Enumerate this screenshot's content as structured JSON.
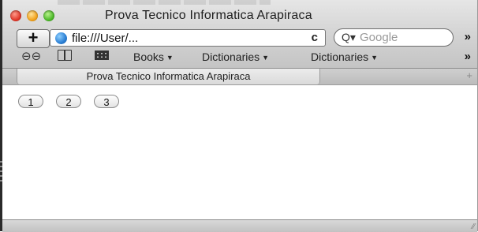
{
  "window": {
    "title": "Prova Tecnico Informatica Arapiraca"
  },
  "toolbar": {
    "add_label": "+",
    "url": "file:///User/...",
    "reload_label": "c",
    "search_placeholder": "Google",
    "search_icon": "Q▾",
    "overflow_label": "»"
  },
  "bookmarks": {
    "items": [
      {
        "label": "Books"
      },
      {
        "label": "Dictionaries"
      },
      {
        "label": "Dictionaries"
      }
    ],
    "overflow_label": "»"
  },
  "tabs": [
    {
      "label": "Prova Tecnico Informatica Arapiraca"
    }
  ],
  "content": {
    "pages": [
      "1",
      "2",
      "3"
    ]
  }
}
